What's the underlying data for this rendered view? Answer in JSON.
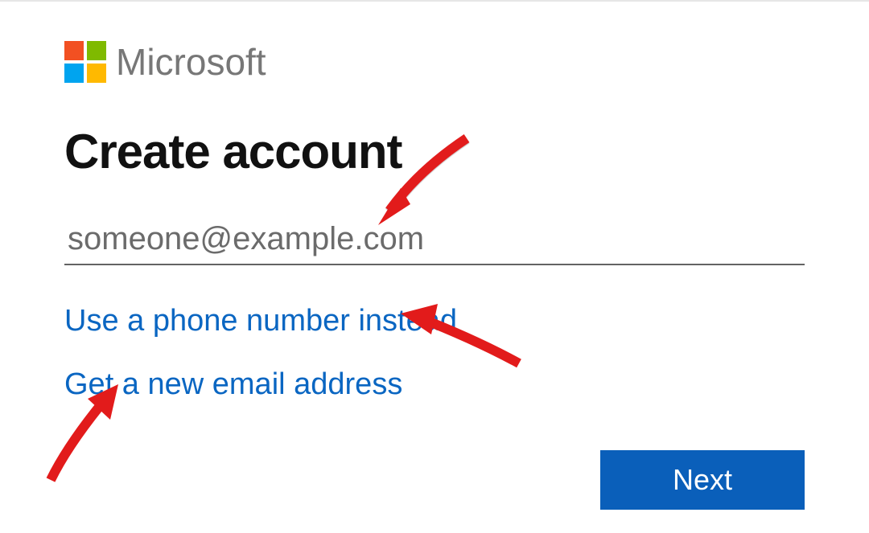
{
  "brand": "Microsoft",
  "heading": "Create account",
  "email": {
    "placeholder": "someone@example.com"
  },
  "links": {
    "phone": "Use a phone number instead",
    "newEmail": "Get a new email address"
  },
  "next_label": "Next",
  "colors": {
    "link": "#0a66c2",
    "primary_button": "#0a5fba"
  }
}
